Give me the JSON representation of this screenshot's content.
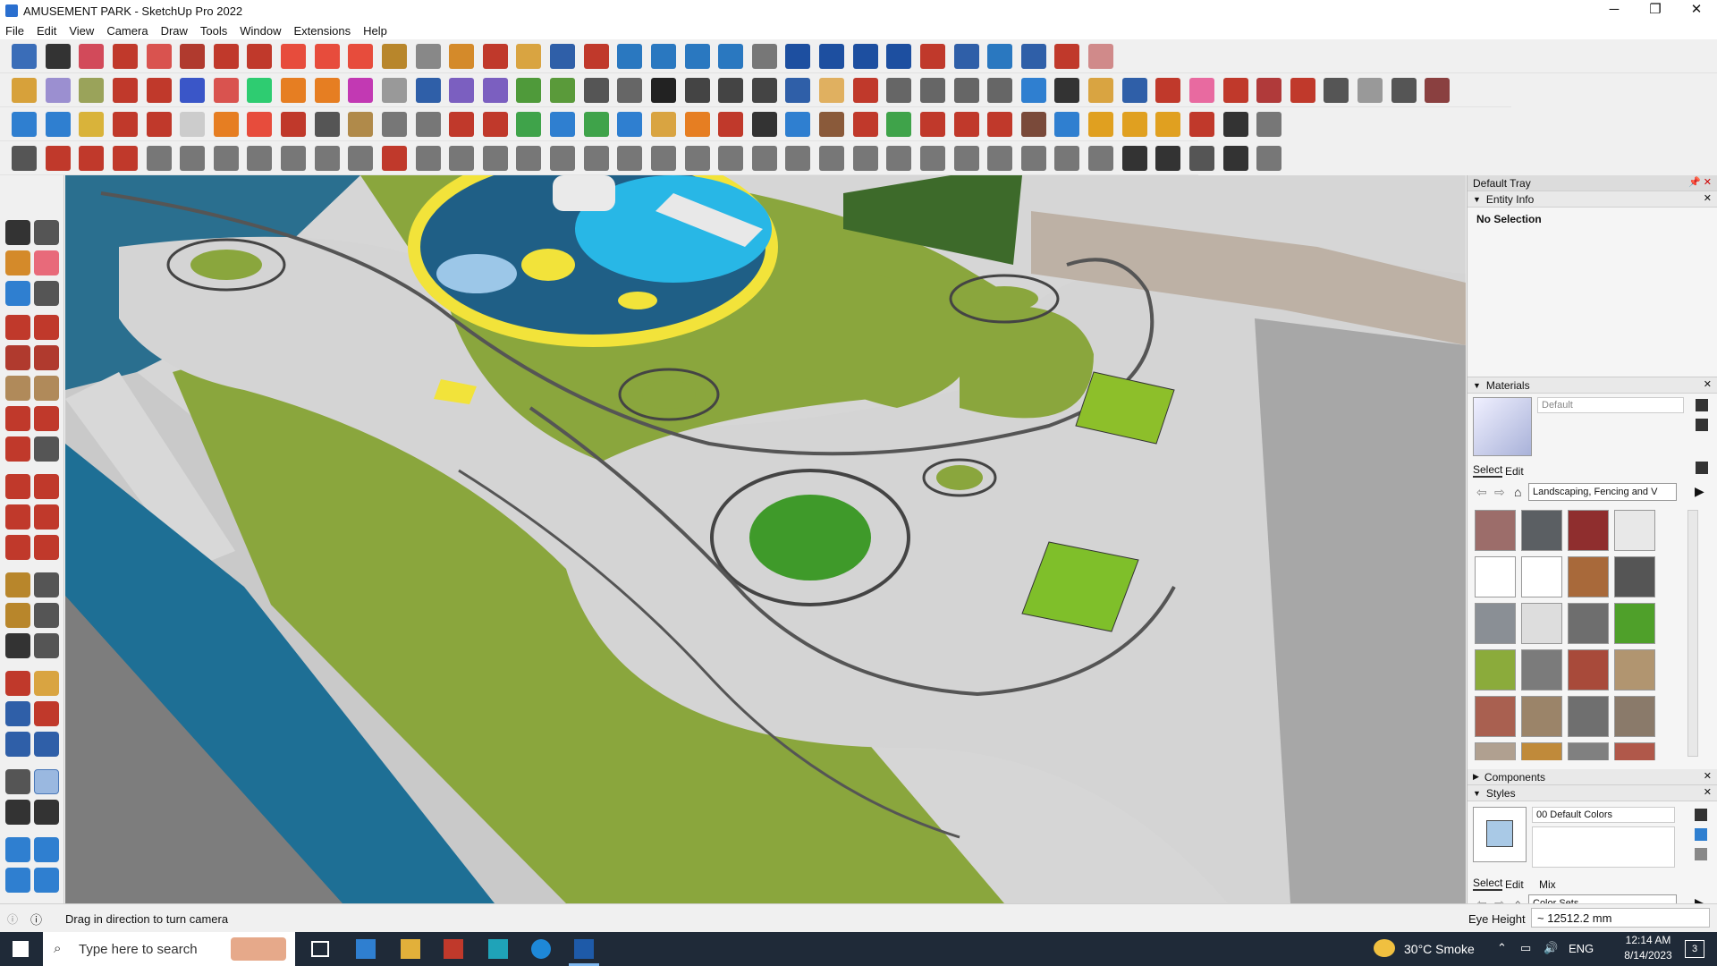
{
  "window": {
    "title": "AMUSEMENT PARK - SketchUp Pro 2022",
    "min": "─",
    "max": "❐",
    "close": "✕"
  },
  "menu": [
    "File",
    "Edit",
    "View",
    "Camera",
    "Draw",
    "Tools",
    "Window",
    "Extensions",
    "Help"
  ],
  "tray": {
    "title": "Default Tray",
    "entity_info": {
      "label": "Entity Info",
      "selection": "No Selection"
    },
    "materials": {
      "label": "Materials",
      "current": "Default",
      "tab_select": "Select",
      "tab_edit": "Edit",
      "collection": "Landscaping, Fencing and V"
    },
    "components": {
      "label": "Components"
    },
    "styles": {
      "label": "Styles",
      "current": "00 Default Colors",
      "tab_select": "Select",
      "tab_edit": "Edit",
      "tab_mix": "Mix",
      "collection": "Color Sets"
    }
  },
  "status": {
    "hint": "Drag in direction to turn camera",
    "measure_label": "Eye Height",
    "measure_value": "~ 12512.2 mm"
  },
  "taskbar": {
    "search_placeholder": "Type here to search",
    "weather": "30°C  Smoke",
    "lang": "ENG",
    "time": "12:14 AM",
    "date": "8/14/2023",
    "notif_count": "3"
  },
  "colors": {
    "grass": "#8aa63d",
    "paving": "#d4d4d4",
    "water": "#1e6f95",
    "pool": "#1f5f86",
    "accent": "#f2e33a"
  }
}
